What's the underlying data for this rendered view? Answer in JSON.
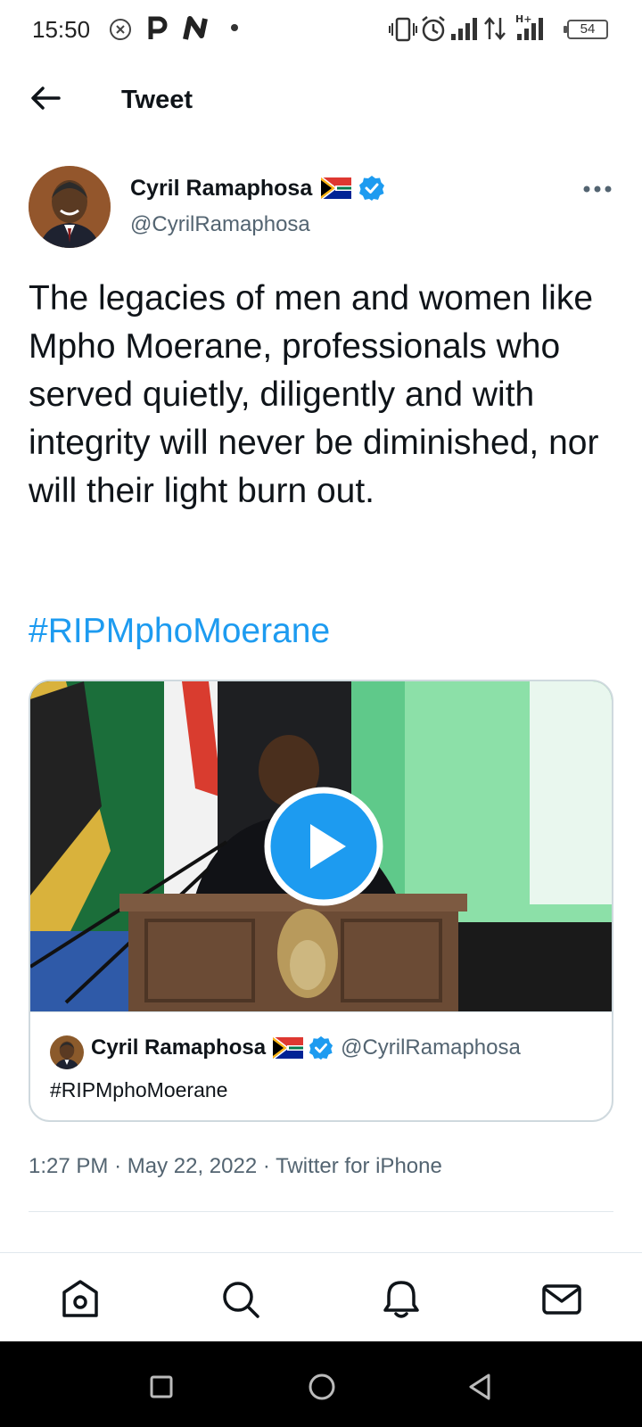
{
  "status_bar": {
    "time": "15:50",
    "battery": "54",
    "left_icons": [
      "close-circle-icon",
      "p-icon",
      "n-icon",
      "dot-icon"
    ],
    "right_icons": [
      "vibrate-icon",
      "alarm-icon",
      "signal-icon",
      "data-arrows-icon",
      "hplus-signal-icon"
    ]
  },
  "header": {
    "title": "Tweet",
    "back_icon": "arrow-left-icon"
  },
  "tweet": {
    "author_name": "Cyril Ramaphosa",
    "author_handle": "@CyrilRamaphosa",
    "text": "The legacies of men and women like Mpho Moerane, professionals who served quietly, diligently and with integrity will never be diminished, nor will their light burn out.",
    "hashtag": "#RIPMphoMoerane",
    "media": {
      "type": "video",
      "quote_author_name": "Cyril Ramaphosa",
      "quote_author_handle": "@CyrilRamaphosa",
      "quote_text": "#RIPMphoMoerane"
    },
    "time": "1:27 PM",
    "separator": "·",
    "date": "May 22, 2022",
    "source": "Twitter for iPhone"
  },
  "bottom_nav": {
    "items": [
      "home-icon",
      "search-icon",
      "notifications-icon",
      "messages-icon"
    ]
  },
  "colors": {
    "accent": "#1d9bf0",
    "secondary_text": "#536471",
    "primary_text": "#0f1419"
  }
}
